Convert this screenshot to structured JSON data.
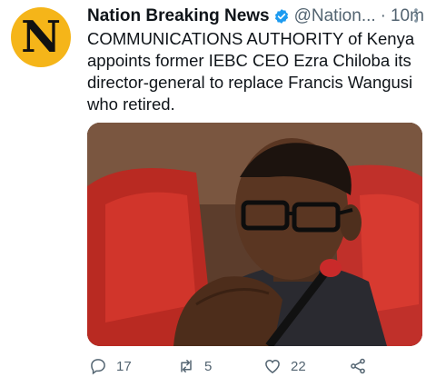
{
  "tweet": {
    "avatar_letter": "N",
    "display_name": "Nation Breaking News",
    "handle": "@Nation...",
    "separator": "·",
    "time": "10m",
    "text": "COMMUNICATIONS AUTHORITY of Kenya appoints former IEBC CEO Ezra Chiloba its director-general to replace Francis Wangusi who retired."
  },
  "actions": {
    "reply_count": "17",
    "retweet_count": "5",
    "like_count": "22"
  },
  "icons": {
    "verified": "verified-badge-icon",
    "more": "more-options-icon",
    "reply": "reply-icon",
    "retweet": "retweet-icon",
    "like": "heart-icon",
    "share": "share-icon"
  },
  "colors": {
    "avatar_bg": "#f5b519",
    "verified": "#1d9bf0",
    "muted": "#536471",
    "text": "#0f1419"
  }
}
